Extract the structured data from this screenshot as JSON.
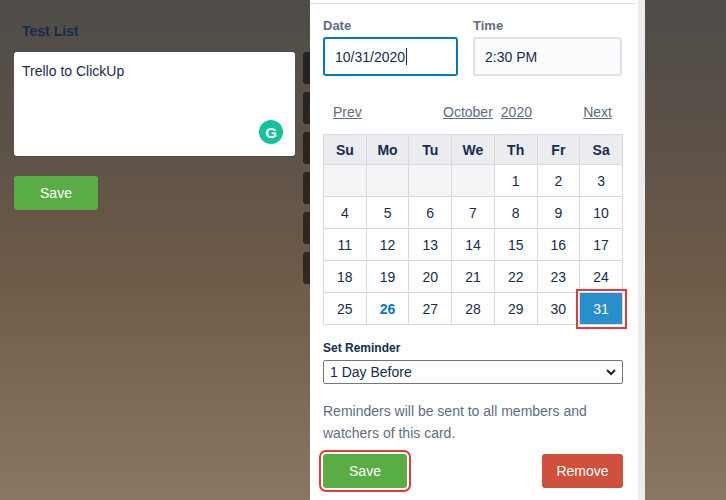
{
  "list": {
    "title": "Test List",
    "menu": "···",
    "card_text": "Trello to ClickUp",
    "grammarly": "G",
    "save": "Save"
  },
  "date_picker": {
    "date_label": "Date",
    "date_value": "10/31/2020",
    "date_focused": true,
    "time_label": "Time",
    "time_value": "2:30 PM",
    "prev": "Prev",
    "next": "Next",
    "month": "October",
    "year": "2020",
    "weekdays": [
      "Su",
      "Mo",
      "Tu",
      "We",
      "Th",
      "Fr",
      "Sa"
    ],
    "weeks": [
      [
        {
          "day": "",
          "today": false,
          "selected": false,
          "highlighted": false
        },
        {
          "day": "",
          "today": false,
          "selected": false,
          "highlighted": false
        },
        {
          "day": "",
          "today": false,
          "selected": false,
          "highlighted": false
        },
        {
          "day": "",
          "today": false,
          "selected": false,
          "highlighted": false
        },
        {
          "day": "1",
          "today": false,
          "selected": false,
          "highlighted": false
        },
        {
          "day": "2",
          "today": false,
          "selected": false,
          "highlighted": false
        },
        {
          "day": "3",
          "today": false,
          "selected": false,
          "highlighted": false
        }
      ],
      [
        {
          "day": "4",
          "today": false,
          "selected": false,
          "highlighted": false
        },
        {
          "day": "5",
          "today": false,
          "selected": false,
          "highlighted": false
        },
        {
          "day": "6",
          "today": false,
          "selected": false,
          "highlighted": false
        },
        {
          "day": "7",
          "today": false,
          "selected": false,
          "highlighted": false
        },
        {
          "day": "8",
          "today": false,
          "selected": false,
          "highlighted": false
        },
        {
          "day": "9",
          "today": false,
          "selected": false,
          "highlighted": false
        },
        {
          "day": "10",
          "today": false,
          "selected": false,
          "highlighted": false
        }
      ],
      [
        {
          "day": "11",
          "today": false,
          "selected": false,
          "highlighted": false
        },
        {
          "day": "12",
          "today": false,
          "selected": false,
          "highlighted": false
        },
        {
          "day": "13",
          "today": false,
          "selected": false,
          "highlighted": false
        },
        {
          "day": "14",
          "today": false,
          "selected": false,
          "highlighted": false
        },
        {
          "day": "15",
          "today": false,
          "selected": false,
          "highlighted": false
        },
        {
          "day": "16",
          "today": false,
          "selected": false,
          "highlighted": false
        },
        {
          "day": "17",
          "today": false,
          "selected": false,
          "highlighted": false
        }
      ],
      [
        {
          "day": "18",
          "today": false,
          "selected": false,
          "highlighted": false
        },
        {
          "day": "19",
          "today": false,
          "selected": false,
          "highlighted": false
        },
        {
          "day": "20",
          "today": false,
          "selected": false,
          "highlighted": false
        },
        {
          "day": "21",
          "today": false,
          "selected": false,
          "highlighted": false
        },
        {
          "day": "22",
          "today": false,
          "selected": false,
          "highlighted": false
        },
        {
          "day": "23",
          "today": false,
          "selected": false,
          "highlighted": false
        },
        {
          "day": "24",
          "today": false,
          "selected": false,
          "highlighted": false
        }
      ],
      [
        {
          "day": "25",
          "today": false,
          "selected": false,
          "highlighted": false
        },
        {
          "day": "26",
          "today": true,
          "selected": false,
          "highlighted": false
        },
        {
          "day": "27",
          "today": false,
          "selected": false,
          "highlighted": false
        },
        {
          "day": "28",
          "today": false,
          "selected": false,
          "highlighted": false
        },
        {
          "day": "29",
          "today": false,
          "selected": false,
          "highlighted": false
        },
        {
          "day": "30",
          "today": false,
          "selected": false,
          "highlighted": false
        },
        {
          "day": "31",
          "today": false,
          "selected": true,
          "highlighted": true
        }
      ]
    ],
    "reminder_label": "Set Reminder",
    "reminder_value": "1 Day Before",
    "note": "Reminders will be sent to all members and watchers of this card.",
    "save": "Save",
    "save_highlighted": true,
    "remove": "Remove"
  }
}
